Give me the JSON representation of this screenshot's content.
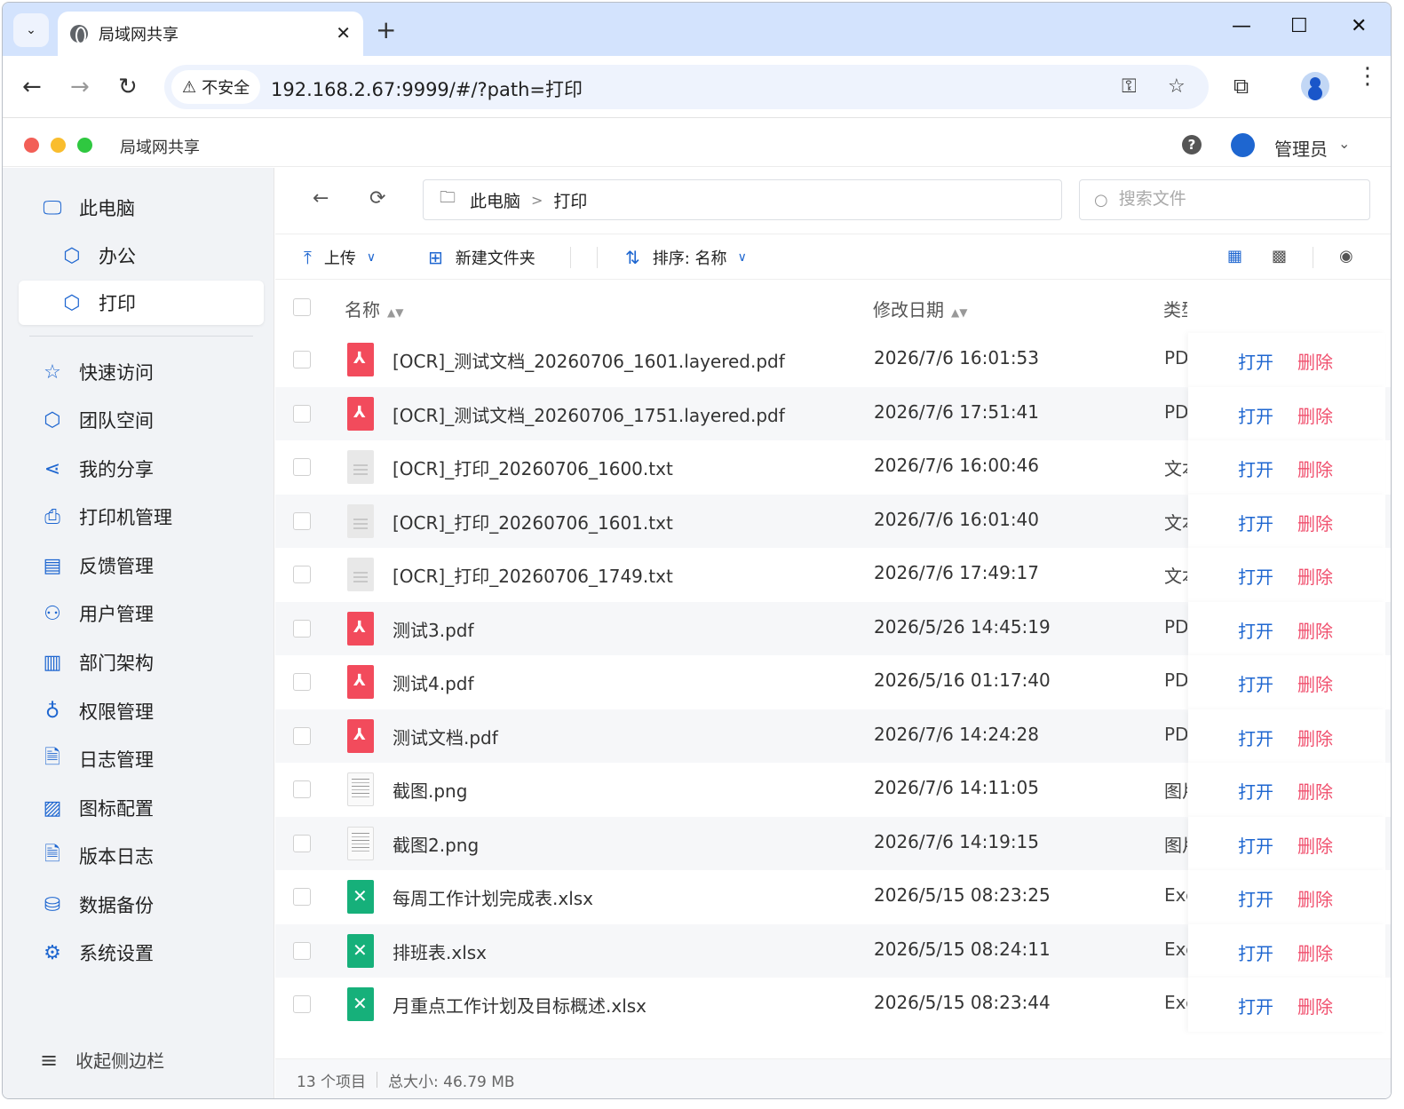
{
  "browser": {
    "tab_title": "局域网共享",
    "security_label": "不安全",
    "url": "192.168.2.67:9999/#/?path=打印",
    "icons": [
      "tab-dropdown-icon",
      "globe-icon",
      "close-icon",
      "new-tab-icon",
      "minimize-icon",
      "maximize-icon",
      "window-close-icon",
      "back-icon",
      "forward-icon",
      "reload-icon",
      "key-icon",
      "star-icon",
      "extensions-icon",
      "profile-icon",
      "menu-icon"
    ]
  },
  "app": {
    "title": "局域网共享",
    "user_name": "管理员"
  },
  "sidebar": {
    "items": [
      {
        "label": "此电脑",
        "icon": "monitor-icon"
      },
      {
        "label": "办公",
        "icon": "chip-icon"
      },
      {
        "label": "打印",
        "icon": "chip-icon"
      },
      {
        "label": "快速访问",
        "icon": "star-icon"
      },
      {
        "label": "团队空间",
        "icon": "chip-icon"
      },
      {
        "label": "我的分享",
        "icon": "share-icon"
      },
      {
        "label": "打印机管理",
        "icon": "printer-icon"
      },
      {
        "label": "反馈管理",
        "icon": "feedback-icon"
      },
      {
        "label": "用户管理",
        "icon": "user-icon"
      },
      {
        "label": "部门架构",
        "icon": "building-icon"
      },
      {
        "label": "权限管理",
        "icon": "key-icon"
      },
      {
        "label": "日志管理",
        "icon": "document-icon"
      },
      {
        "label": "图标配置",
        "icon": "image-icon"
      },
      {
        "label": "版本日志",
        "icon": "document-icon"
      },
      {
        "label": "数据备份",
        "icon": "backup-icon"
      },
      {
        "label": "系统设置",
        "icon": "gear-icon"
      }
    ],
    "collapse_label": "收起侧边栏"
  },
  "breadcrumb": {
    "root": "此电脑",
    "current": "打印"
  },
  "search": {
    "placeholder": "搜索文件"
  },
  "toolbar": {
    "upload_label": "上传",
    "new_folder_label": "新建文件夹",
    "sort_label": "排序: 名称"
  },
  "table": {
    "headers": {
      "name": "名称",
      "date": "修改日期",
      "type": "类型"
    },
    "open_label": "打开",
    "delete_label": "删除",
    "rows": [
      {
        "name": "[OCR]_测试文档_20260706_1601.layered.pdf",
        "date": "2026/7/6 16:01:53",
        "type": "PDF",
        "kind": "pdf"
      },
      {
        "name": "[OCR]_测试文档_20260706_1751.layered.pdf",
        "date": "2026/7/6 17:51:41",
        "type": "PDF",
        "kind": "pdf"
      },
      {
        "name": "[OCR]_打印_20260706_1600.txt",
        "date": "2026/7/6 16:00:46",
        "type": "文本",
        "kind": "txt"
      },
      {
        "name": "[OCR]_打印_20260706_1601.txt",
        "date": "2026/7/6 16:01:40",
        "type": "文本",
        "kind": "txt"
      },
      {
        "name": "[OCR]_打印_20260706_1749.txt",
        "date": "2026/7/6 17:49:17",
        "type": "文本",
        "kind": "txt"
      },
      {
        "name": "测试3.pdf",
        "date": "2026/5/26 14:45:19",
        "type": "PDF",
        "kind": "pdf"
      },
      {
        "name": "测试4.pdf",
        "date": "2026/5/16 01:17:40",
        "type": "PDF",
        "kind": "pdf"
      },
      {
        "name": "测试文档.pdf",
        "date": "2026/7/6 14:24:28",
        "type": "PDF",
        "kind": "pdf"
      },
      {
        "name": "截图.png",
        "date": "2026/7/6 14:11:05",
        "type": "图片",
        "kind": "img"
      },
      {
        "name": "截图2.png",
        "date": "2026/7/6 14:19:15",
        "type": "图片",
        "kind": "img"
      },
      {
        "name": "每周工作计划完成表.xlsx",
        "date": "2026/5/15 08:23:25",
        "type": "Excel",
        "kind": "xlsx"
      },
      {
        "name": "排班表.xlsx",
        "date": "2026/5/15 08:24:11",
        "type": "Excel",
        "kind": "xlsx"
      },
      {
        "name": "月重点工作计划及目标概述.xlsx",
        "date": "2026/5/15 08:23:44",
        "type": "Excel",
        "kind": "xlsx"
      }
    ]
  },
  "status": {
    "count": "13 个项目",
    "total_size": "总大小: 46.79 MB"
  },
  "colors": {
    "accent": "#1e66d0",
    "danger": "#f0506e",
    "pdf": "#f24b5c",
    "excel": "#16b07a",
    "tabstrip": "#d3e3fd"
  }
}
